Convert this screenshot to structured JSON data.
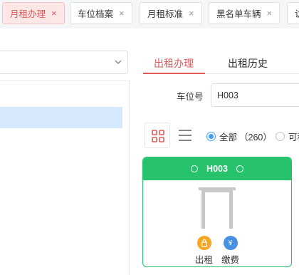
{
  "tabs": [
    {
      "label": "月租办理",
      "active": true
    },
    {
      "label": "车位档案",
      "active": false
    },
    {
      "label": "月租标准",
      "active": false
    },
    {
      "label": "黑名单车辆",
      "active": false
    },
    {
      "label": "访",
      "active": false
    }
  ],
  "close_glyph": "×",
  "right_tabs": [
    {
      "label": "出租办理",
      "active": true
    },
    {
      "label": "出租历史",
      "active": false
    }
  ],
  "field": {
    "label": "车位号",
    "value": "H003"
  },
  "filters": [
    {
      "label": "全部",
      "count": "（260）",
      "checked": true
    },
    {
      "label": "可租",
      "count": "",
      "checked": false
    }
  ],
  "card": {
    "title": "H003",
    "actions": [
      {
        "label": "出租",
        "icon": "lock-icon",
        "color": "#f5a623",
        "glyph": "🔒"
      },
      {
        "label": "缴费",
        "icon": "yen-icon",
        "color": "#4a90e2",
        "glyph": "¥"
      }
    ]
  },
  "colors": {
    "accent": "#e05a5a",
    "available": "#27c26c",
    "selected_row": "#d6e8fb",
    "radio": "#409eff"
  }
}
